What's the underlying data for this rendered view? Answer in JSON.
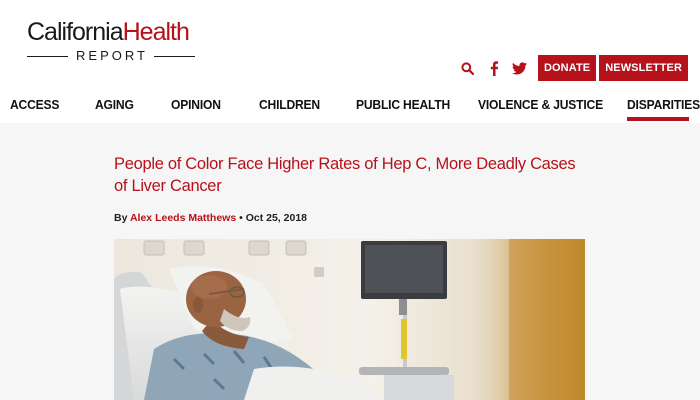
{
  "logo": {
    "part1": "California",
    "part2": "Health",
    "subtitle": "REPORT"
  },
  "header": {
    "search_icon": "search-icon",
    "facebook_icon": "facebook-icon",
    "twitter_icon": "twitter-icon",
    "donate_label": "DONATE",
    "newsletter_label": "NEWSLETTER"
  },
  "nav": {
    "items": [
      "ACCESS",
      "AGING",
      "OPINION",
      "CHILDREN",
      "PUBLIC HEALTH",
      "VIOLENCE & JUSTICE",
      "DISPARITIES"
    ],
    "active": "DISPARITIES"
  },
  "article": {
    "title": "People of Color Face Higher Rates of Hep C, More Deadly Cases of Liver Cancer",
    "by": "By",
    "author": "Alex Leeds Matthews",
    "separator": "•",
    "date": "Oct 25, 2018"
  },
  "colors": {
    "brand_red": "#b5121b",
    "text": "#111111"
  }
}
